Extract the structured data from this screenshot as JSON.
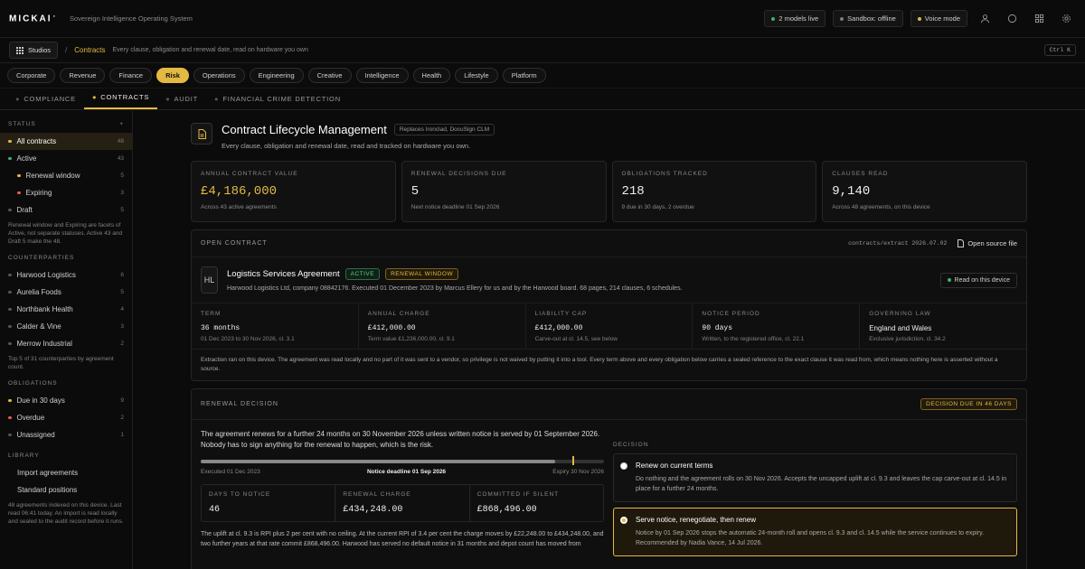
{
  "app": {
    "logo": "MICKAI",
    "tagline": "Sovereign Intelligence Operating System"
  },
  "top": {
    "models": "2 models live",
    "sandbox": "Sandbox: offline",
    "voice": "Voice mode"
  },
  "crumb": {
    "studios": "Studios",
    "current": "Contracts",
    "desc": "Every clause, obligation and renewal date, read on hardware you own",
    "shortcut": "Ctrl K"
  },
  "depts": [
    "Corporate",
    "Revenue",
    "Finance",
    "Risk",
    "Operations",
    "Engineering",
    "Creative",
    "Intelligence",
    "Health",
    "Lifestyle",
    "Platform"
  ],
  "tabs": [
    "COMPLIANCE",
    "CONTRACTS",
    "AUDIT",
    "FINANCIAL CRIME DETECTION"
  ],
  "sidebar": {
    "status_title": "STATUS",
    "status": [
      {
        "label": "All contracts",
        "count": "48"
      },
      {
        "label": "Active",
        "count": "43"
      },
      {
        "label": "Renewal window",
        "count": "5"
      },
      {
        "label": "Expiring",
        "count": "3"
      },
      {
        "label": "Draft",
        "count": "5"
      }
    ],
    "status_note": "Renewal window and Expiring are facets of Active, not separate statuses. Active 43 and Draft 5 make the 48.",
    "cp_title": "COUNTERPARTIES",
    "counterparties": [
      {
        "label": "Harwood Logistics",
        "count": "6"
      },
      {
        "label": "Aurelia Foods",
        "count": "5"
      },
      {
        "label": "Northbank Health",
        "count": "4"
      },
      {
        "label": "Calder & Vine",
        "count": "3"
      },
      {
        "label": "Merrow Industrial",
        "count": "2"
      }
    ],
    "cp_note": "Top 5 of 31 counterparties by agreement count.",
    "ob_title": "OBLIGATIONS",
    "obligations": [
      {
        "label": "Due in 30 days",
        "count": "9"
      },
      {
        "label": "Overdue",
        "count": "2"
      },
      {
        "label": "Unassigned",
        "count": "1"
      }
    ],
    "lib_title": "LIBRARY",
    "library": [
      "Import agreements",
      "Standard positions"
    ],
    "lib_note": "48 agreements indexed on this device. Last read 06:41 today. An import is read locally and sealed to the audit record before it runs."
  },
  "header": {
    "title": "Contract Lifecycle Management",
    "replaces": "Replaces Ironclad, DocuSign CLM",
    "subtitle": "Every clause, obligation and renewal date, read and tracked on hardware you own."
  },
  "stats": [
    {
      "label": "ANNUAL CONTRACT VALUE",
      "value": "£4,186,000",
      "note": "Across 43 active agreements"
    },
    {
      "label": "RENEWAL DECISIONS DUE",
      "value": "5",
      "note": "Next notice deadline 01 Sep 2026"
    },
    {
      "label": "OBLIGATIONS TRACKED",
      "value": "218",
      "note": "9 due in 30 days, 2 overdue"
    },
    {
      "label": "CLAUSES READ",
      "value": "9,140",
      "note": "Across 48 agreements, on this device"
    }
  ],
  "open": {
    "label": "OPEN CONTRACT",
    "path": "contracts/extract 2026.07.02",
    "source_btn": "Open source file",
    "initials": "HL",
    "title": "Logistics Services Agreement",
    "badge_active": "ACTIVE",
    "badge_renewal": "RENEWAL WINDOW",
    "sub": "Harwood Logistics Ltd, company 08842176. Executed 01 December 2023 by Marcus Ellery for us and by the Harwood board. 68 pages, 214 clauses, 6 schedules.",
    "read_btn": "Read on this device",
    "terms": [
      {
        "label": "TERM",
        "value": "36 months",
        "note": "01 Dec 2023 to 30 Nov 2026, cl. 3.1"
      },
      {
        "label": "ANNUAL CHARGE",
        "value": "£412,000.00",
        "note": "Term value £1,236,000.00, cl. 9.1"
      },
      {
        "label": "LIABILITY CAP",
        "value": "£412,000.00",
        "note": "Carve-out at cl. 14.5, see below"
      },
      {
        "label": "NOTICE PERIOD",
        "value": "90 days",
        "note": "Written, to the registered office, cl. 22.1"
      },
      {
        "label": "GOVERNING LAW",
        "value": "England and Wales",
        "note": "Exclusive jurisdiction, cl. 34.2"
      }
    ],
    "extract_note": "Extraction ran on this device. The agreement was read locally and no part of it was sent to a vendor, so privilege is not waived by putting it into a tool. Every term above and every obligation below carries a sealed reference to the exact clause it was read from, which means nothing here is asserted without a source."
  },
  "renewal": {
    "label": "RENEWAL DECISION",
    "badge": "DECISION DUE IN 46 DAYS",
    "text": "The agreement renews for a further 24 months on 30 November 2026 unless written notice is served by 01 September 2026. Nobody has to sign anything for the renewal to happen, which is the risk.",
    "progress": 0.879,
    "deadline_pos": 0.921,
    "executed": "Executed 01 Dec 2023",
    "deadline": "Notice deadline 01 Sep 2026",
    "expiry": "Expiry 30 Nov 2026",
    "minis": [
      {
        "label": "DAYS TO NOTICE",
        "value": "46"
      },
      {
        "label": "RENEWAL CHARGE",
        "value": "£434,248.00"
      },
      {
        "label": "COMMITTED IF SILENT",
        "value": "£868,496.00"
      }
    ],
    "para": "The uplift at cl. 9.3 is RPI plus 2 per cent with no ceiling. At the current RPI of 3.4 per cent the charge moves by £22,248.00 to £434,248.00, and two further years at that rate commit £868,496.00. Harwood has served no default notice in 31 months and depot count has moved from",
    "decision_label": "DECISION",
    "options": [
      {
        "title": "Renew on current terms",
        "desc": "Do nothing and the agreement rolls on 30 Nov 2026. Accepts the uncapped uplift at cl. 9.3 and leaves the cap carve-out at cl. 14.5 in place for a further 24 months.",
        "selected": false
      },
      {
        "title": "Serve notice, renegotiate, then renew",
        "desc": "Notice by 01 Sep 2026 stops the automatic 24-month roll and opens cl. 9.3 and cl. 14.5 while the service continues to expiry. Recommended by Nadia Vance, 14 Jul 2026.",
        "selected": true
      }
    ]
  },
  "colors": {
    "accent": "#e3b843",
    "green": "#3fb26b",
    "red": "#e0604c",
    "bg": "#0b0b0b"
  }
}
